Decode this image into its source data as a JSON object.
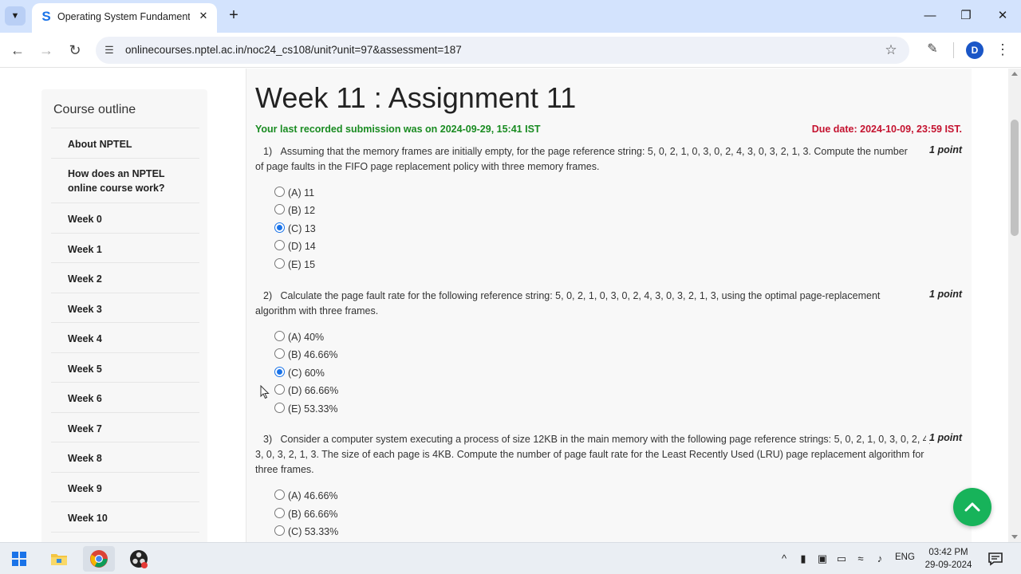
{
  "browser": {
    "tab_title": "Operating System Fundamenta",
    "url": "onlinecourses.nptel.ac.in/noc24_cs108/unit?unit=97&assessment=187",
    "avatar_letter": "D"
  },
  "sidebar": {
    "title": "Course outline",
    "items": [
      {
        "label": "About NPTEL"
      },
      {
        "label": "How does an NPTEL online course work?"
      },
      {
        "label": "Week 0"
      },
      {
        "label": "Week 1"
      },
      {
        "label": "Week 2"
      },
      {
        "label": "Week 3"
      },
      {
        "label": "Week 4"
      },
      {
        "label": "Week 5"
      },
      {
        "label": "Week 6"
      },
      {
        "label": "Week 7"
      },
      {
        "label": "Week 8"
      },
      {
        "label": "Week 9"
      },
      {
        "label": "Week 10"
      }
    ]
  },
  "assignment": {
    "title": "Week 11 : Assignment 11",
    "last_submission": "Your last recorded submission was on 2024-09-29, 15:41 IST",
    "due_date": "Due date: 2024-10-09, 23:59 IST.",
    "questions": [
      {
        "text": "1)   Assuming that the memory frames are initially empty, for the page reference string: 5, 0, 2, 1, 0, 3, 0, 2, 4, 3, 0, 3, 2, 1, 3. Compute the number of page faults in the FIFO page replacement policy with three memory frames.",
        "points": "1 point",
        "options": [
          {
            "label": "(A) 11",
            "selected": false
          },
          {
            "label": "(B) 12",
            "selected": false
          },
          {
            "label": "(C) 13",
            "selected": true
          },
          {
            "label": "(D) 14",
            "selected": false
          },
          {
            "label": "(E) 15",
            "selected": false
          }
        ]
      },
      {
        "text": "2)   Calculate the page fault rate for the following reference string: 5, 0, 2, 1, 0, 3, 0, 2, 4, 3, 0, 3, 2, 1, 3, using the optimal page-replacement algorithm with three frames.",
        "points": "1 point",
        "options": [
          {
            "label": "(A) 40%",
            "selected": false
          },
          {
            "label": "(B) 46.66%",
            "selected": false
          },
          {
            "label": "(C) 60%",
            "selected": true
          },
          {
            "label": "(D) 66.66%",
            "selected": false
          },
          {
            "label": "(E) 53.33%",
            "selected": false
          }
        ]
      },
      {
        "text": "3)   Consider a computer system executing a process of size 12KB in the main memory with the following page reference strings: 5, 0, 2, 1, 0, 3, 0, 2, 4, 3, 0, 3, 2, 1, 3. The size of each page is 4KB. Compute the number of page fault rate for the Least Recently Used (LRU) page replacement algorithm for three frames.",
        "points": "1 point",
        "options": [
          {
            "label": "(A) 46.66%",
            "selected": false
          },
          {
            "label": "(B) 66.66%",
            "selected": false
          },
          {
            "label": "(C) 53.33%",
            "selected": false
          }
        ]
      }
    ]
  },
  "taskbar": {
    "language": "ENG",
    "time": "03:42 PM",
    "date": "29-09-2024"
  },
  "colors": {
    "submission_green": "#198b21",
    "due_red": "#c4122f",
    "radio_blue": "#1a73e8",
    "scroll_button_green": "#17b35a"
  }
}
